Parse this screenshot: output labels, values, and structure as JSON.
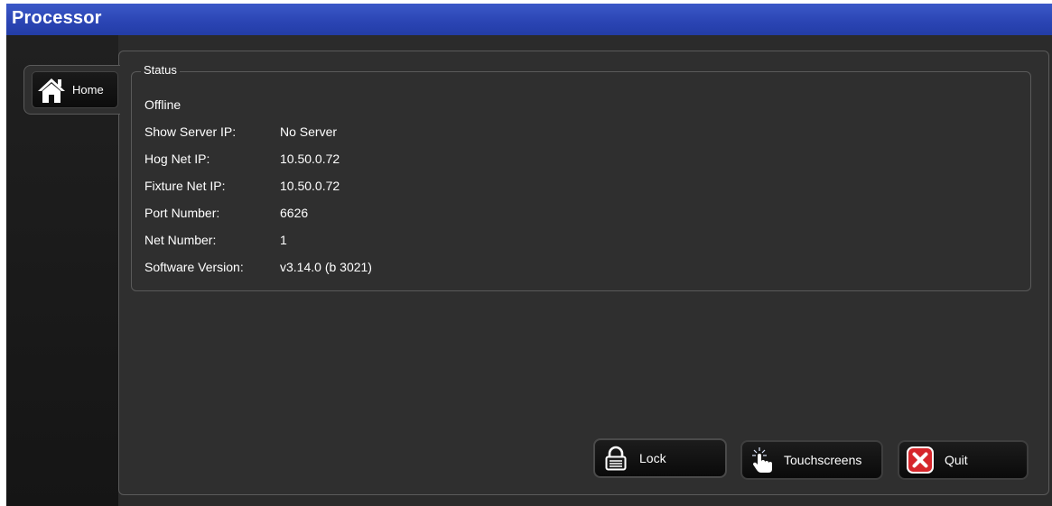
{
  "window": {
    "title": "Processor"
  },
  "tabs": [
    {
      "label": "Home",
      "icon": "home-icon",
      "selected": true
    }
  ],
  "status": {
    "legend": "Status",
    "state": "Offline",
    "rows": [
      {
        "label": "Show Server IP:",
        "value": "No Server"
      },
      {
        "label": "Hog Net IP:",
        "value": "10.50.0.72"
      },
      {
        "label": "Fixture Net IP:",
        "value": "10.50.0.72"
      },
      {
        "label": "Port Number:",
        "value": "6626"
      },
      {
        "label": "Net Number:",
        "value": "1"
      },
      {
        "label": "Software Version:",
        "value": "v3.14.0 (b 3021)"
      }
    ]
  },
  "buttons": {
    "lock": {
      "label": "Lock",
      "icon": "lock-icon"
    },
    "touchscreens": {
      "label": "Touchscreens",
      "icon": "touch-hand-icon"
    },
    "quit": {
      "label": "Quit",
      "icon": "close-x-icon"
    }
  },
  "colors": {
    "title_bar": "#2a44b3",
    "panel": "#2f2f2f",
    "quit_red": "#d6262b"
  }
}
